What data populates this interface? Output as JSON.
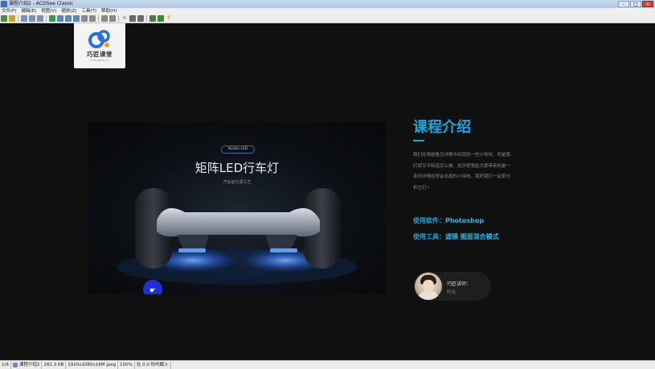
{
  "window": {
    "title": "课程介绍2 - ACDSee Classic"
  },
  "titlebar_controls": {
    "minimize": "–",
    "maximize": "□",
    "close": "✕"
  },
  "menu": [
    "文件(F)",
    "编辑(E)",
    "视图(V)",
    "缩放(Z)",
    "工具(T)",
    "帮助(H)"
  ],
  "logo": {
    "text": "巧匠课堂",
    "sub": "QIAOJIANG.TV"
  },
  "product": {
    "tag": "Nvidia LED",
    "headline": "矩阵LED行车灯",
    "subline": "汽车级光源工艺"
  },
  "course": {
    "title": "课程介绍",
    "description": "我们经常能看见详情中出现的一些小特效，但是我们却又不知道怎么做，这次呢我给大家带来的是一系列详情经常会出现的小特效，我好我们一起来分析它们~",
    "software_label": "使用软件：",
    "software_value": "Photoshop",
    "tools_label": "使用工具：",
    "tools_value": "滤镜 图层混合模式"
  },
  "teacher": {
    "label": "巧匠讲师：",
    "name": "阿浩"
  },
  "status": {
    "index": "1/6",
    "filename": "课程介绍2",
    "filesize": "282.3 KB",
    "dimensions": "1920x1080x16M jpeg",
    "zoom": "100%",
    "loadtime": "在 0.0 秒内载入"
  },
  "colors": {
    "accent": "#1aa7e0",
    "led": "#3f8dff",
    "cursor": "#1f2fd6"
  }
}
